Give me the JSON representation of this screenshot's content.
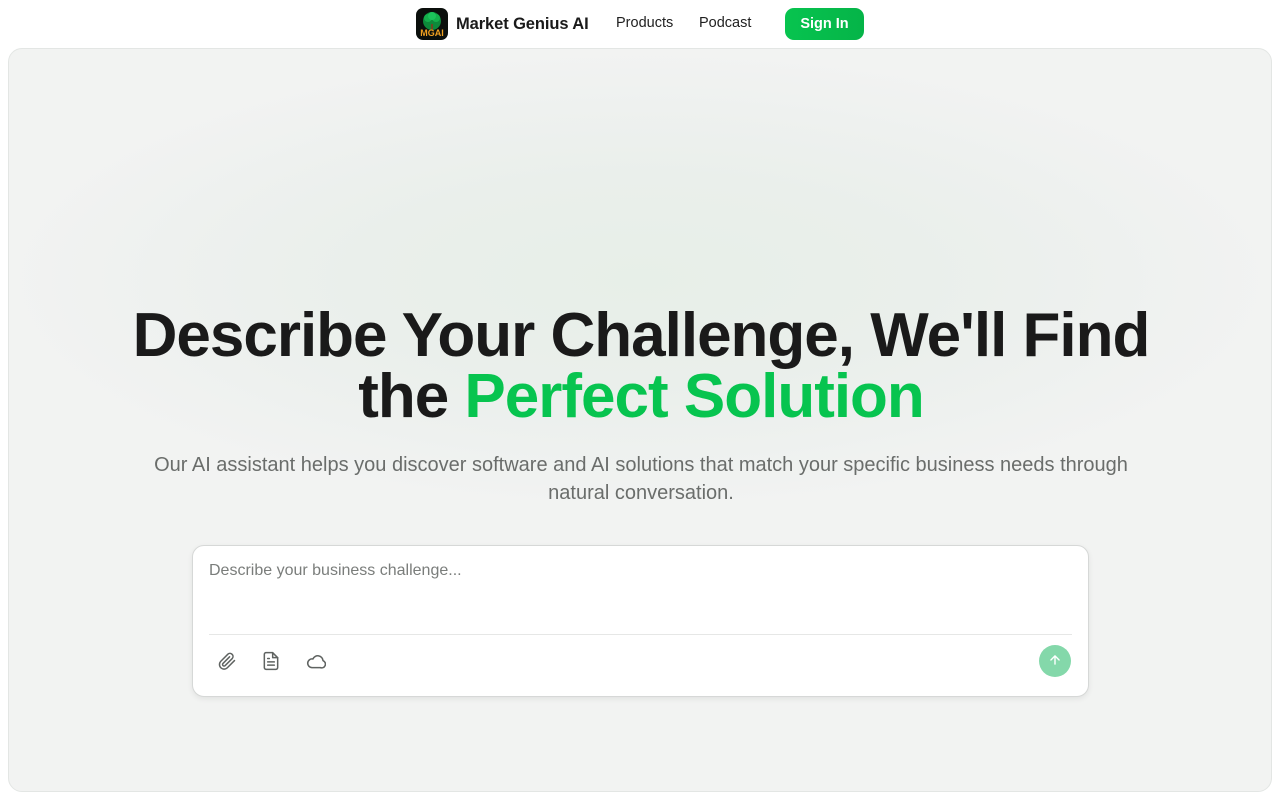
{
  "brand": {
    "name": "Market Genius AI",
    "logo_text": "MGAI"
  },
  "nav": {
    "products": "Products",
    "podcast": "Podcast",
    "sign_in": "Sign In"
  },
  "hero": {
    "headline_line1": "Describe Your Challenge, We'll Find",
    "headline_line2_prefix": "the ",
    "headline_line2_accent": "Perfect Solution",
    "subtitle": "Our AI assistant helps you discover software and AI solutions that match your specific business needs through natural conversation."
  },
  "composer": {
    "placeholder": "Describe your business challenge...",
    "value": "",
    "tools": [
      "paperclip-icon",
      "document-icon",
      "cloud-icon"
    ],
    "send_icon": "arrow-up-icon"
  },
  "colors": {
    "accent": "#07c44f",
    "send_disabled": "#84d8aa",
    "text": "#1a1a1a",
    "muted": "#6a6d6b"
  }
}
